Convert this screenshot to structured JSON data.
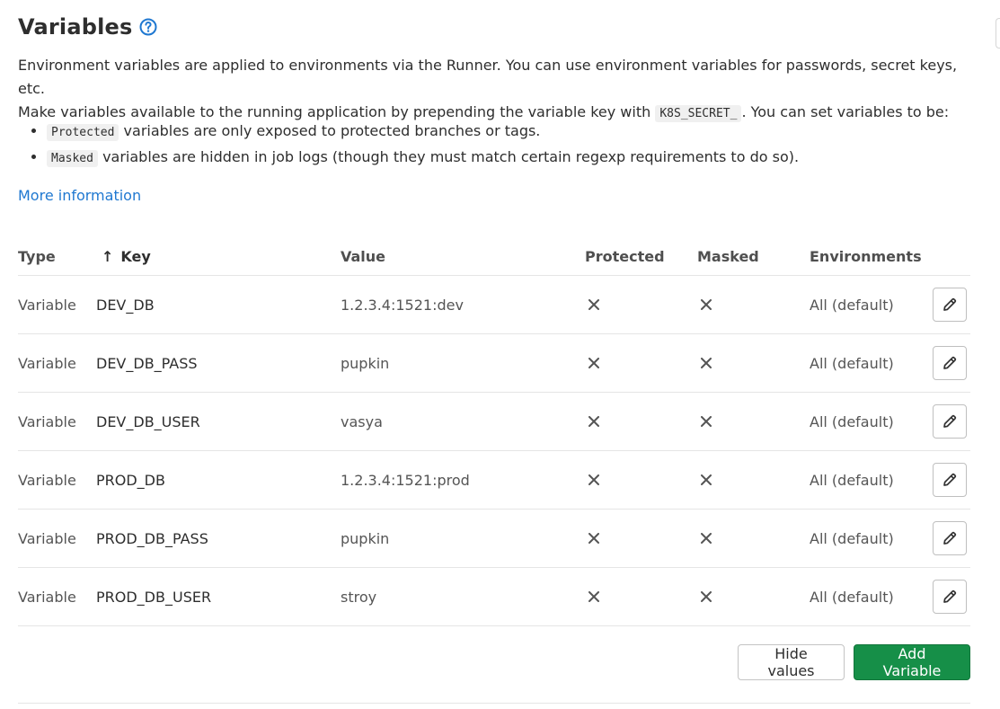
{
  "header": {
    "title": "Variables"
  },
  "intro": {
    "line1": "Environment variables are applied to environments via the Runner. You can use environment variables for passwords, secret keys, etc.",
    "line2_before": "Make variables available to the running application by prepending the variable key with",
    "line2_code": "K8S_SECRET_",
    "line2_after": ". You can set variables to be:"
  },
  "bullets": [
    {
      "code": "Protected",
      "text": "variables are only exposed to protected branches or tags."
    },
    {
      "code": "Masked",
      "text": "variables are hidden in job logs (though they must match certain regexp requirements to do so)."
    }
  ],
  "more_info_link": "More information",
  "table": {
    "headers": {
      "type": "Type",
      "key": "Key",
      "value": "Value",
      "protected": "Protected",
      "masked": "Masked",
      "environments": "Environments"
    },
    "sort_indicator": "↑",
    "rows": [
      {
        "type": "Variable",
        "key": "DEV_DB",
        "value": "1.2.3.4:1521:dev",
        "protected": false,
        "masked": false,
        "environment": "All (default)"
      },
      {
        "type": "Variable",
        "key": "DEV_DB_PASS",
        "value": "pupkin",
        "protected": false,
        "masked": false,
        "environment": "All (default)"
      },
      {
        "type": "Variable",
        "key": "DEV_DB_USER",
        "value": "vasya",
        "protected": false,
        "masked": false,
        "environment": "All (default)"
      },
      {
        "type": "Variable",
        "key": "PROD_DB",
        "value": "1.2.3.4:1521:prod",
        "protected": false,
        "masked": false,
        "environment": "All (default)"
      },
      {
        "type": "Variable",
        "key": "PROD_DB_PASS",
        "value": "pupkin",
        "protected": false,
        "masked": false,
        "environment": "All (default)"
      },
      {
        "type": "Variable",
        "key": "PROD_DB_USER",
        "value": "stroy",
        "protected": false,
        "masked": false,
        "environment": "All (default)"
      }
    ]
  },
  "actions": {
    "hide_values": "Hide values",
    "add_variable": "Add Variable"
  },
  "colors": {
    "link": "#1f78d1",
    "success": "#168f48",
    "border": "#e5e5e5"
  },
  "icons": {
    "help": "question-circle-icon",
    "sort": "arrow-up-icon",
    "unset": "close-x-icon",
    "edit": "pencil-icon"
  }
}
